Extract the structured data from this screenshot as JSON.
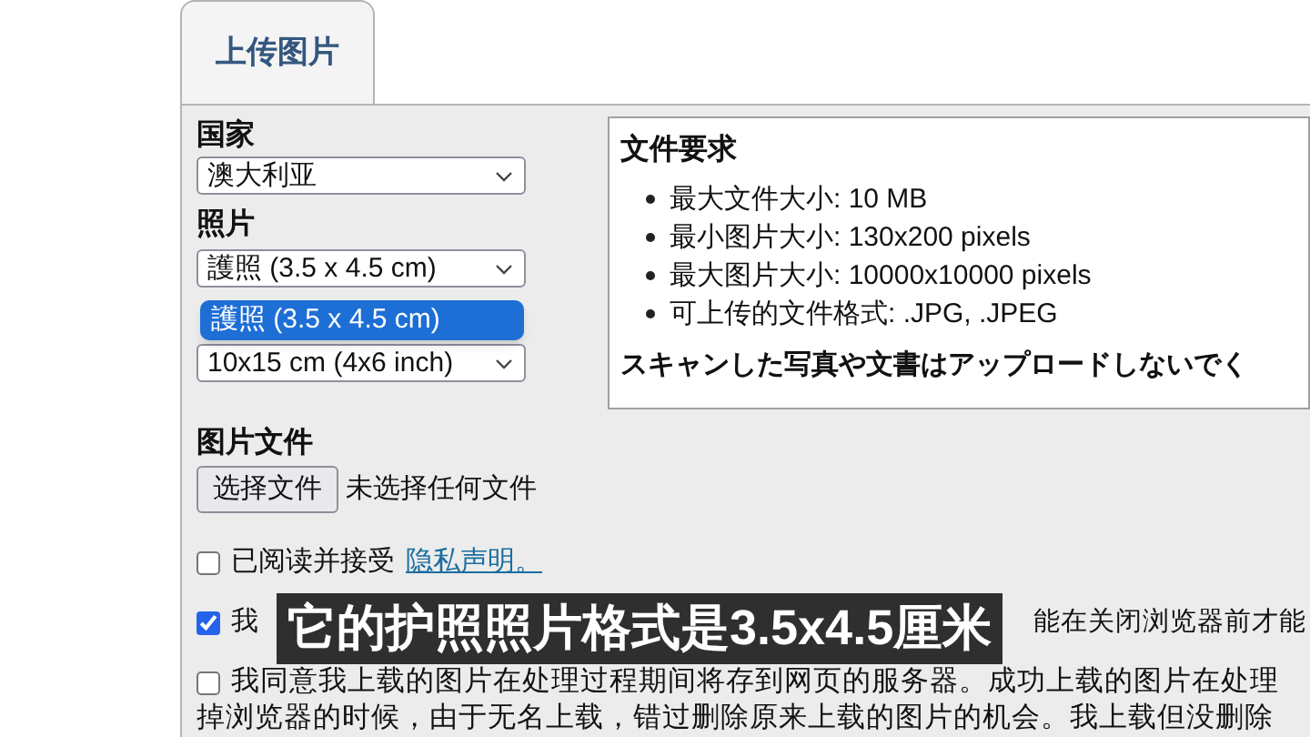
{
  "tab": {
    "label": "上传图片",
    "selected": true
  },
  "country": {
    "label": "国家",
    "value": "澳大利亚"
  },
  "photo": {
    "label": "照片",
    "value": "護照 (3.5 x 4.5 cm)",
    "open_option": {
      "label": "護照 (3.5 x 4.5 cm)",
      "selected": true
    }
  },
  "print_size": {
    "value": "10x15 cm (4x6 inch)"
  },
  "file": {
    "label": "图片文件",
    "button": "选择文件",
    "status": "未选择任何文件"
  },
  "requirements": {
    "title": "文件要求",
    "items": [
      "最大文件大小: 10 MB",
      "最小图片大小: 130x200 pixels",
      "最大图片大小: 10000x10000 pixels",
      "可上传的文件格式: .JPG, .JPEG"
    ],
    "note": "スキャンした写真や文書はアップロードしないでく"
  },
  "consents": [
    {
      "kind": "link",
      "checked": false,
      "text": "已阅读并接受",
      "link": "隐私声明。"
    },
    {
      "kind": "split",
      "checked": true,
      "text_start": "我",
      "text_end": "能在关闭浏览器前才能"
    },
    {
      "kind": "lines",
      "checked": false,
      "lines": [
        "我同意我上载的图片在处理过程期间将存到网页的服务器。成功上载的图片在处理",
        "掉浏览器的时候，由于无名上载，错过删除原来上载的图片的机会。我上载但没删除"
      ]
    }
  ],
  "subtitle": "它的护照照片格式是3.5x4.5厘米"
}
